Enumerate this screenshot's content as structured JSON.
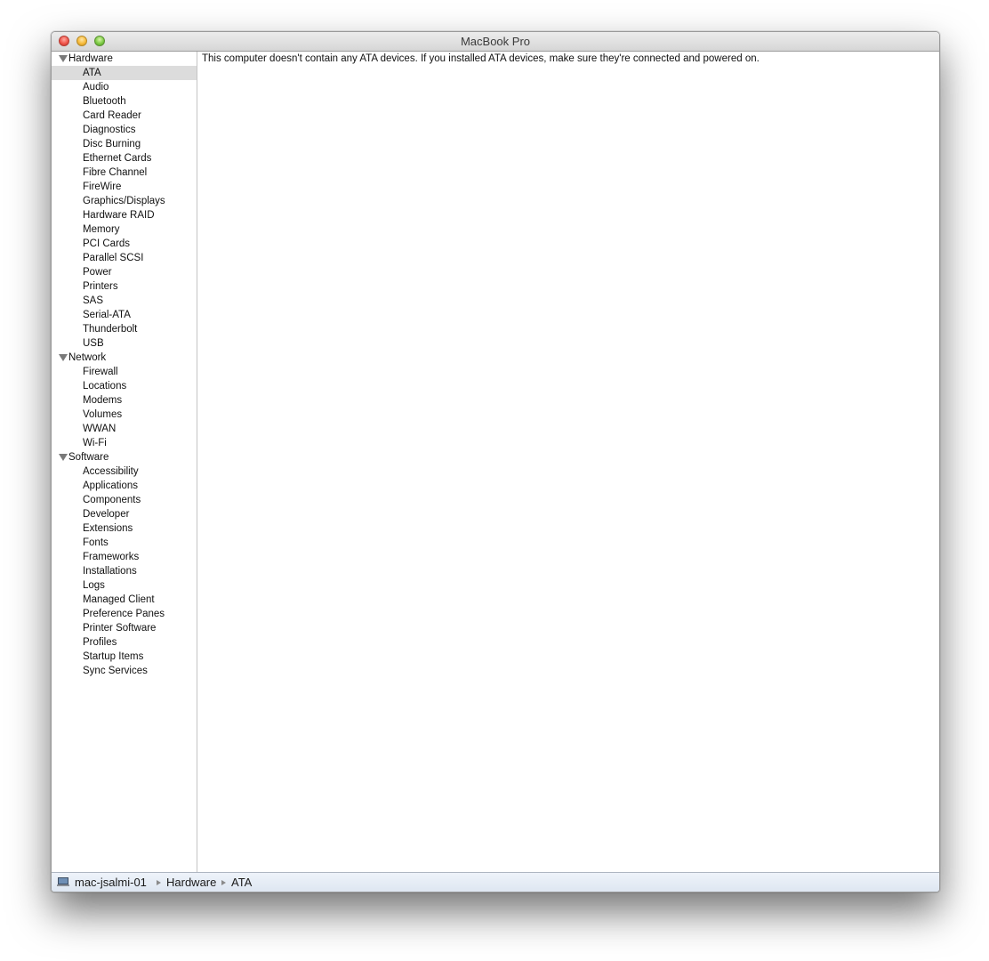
{
  "window": {
    "title": "MacBook Pro"
  },
  "sidebar": {
    "groups": [
      {
        "label": "Hardware",
        "items": [
          "ATA",
          "Audio",
          "Bluetooth",
          "Card Reader",
          "Diagnostics",
          "Disc Burning",
          "Ethernet Cards",
          "Fibre Channel",
          "FireWire",
          "Graphics/Displays",
          "Hardware RAID",
          "Memory",
          "PCI Cards",
          "Parallel SCSI",
          "Power",
          "Printers",
          "SAS",
          "Serial-ATA",
          "Thunderbolt",
          "USB"
        ]
      },
      {
        "label": "Network",
        "items": [
          "Firewall",
          "Locations",
          "Modems",
          "Volumes",
          "WWAN",
          "Wi-Fi"
        ]
      },
      {
        "label": "Software",
        "items": [
          "Accessibility",
          "Applications",
          "Components",
          "Developer",
          "Extensions",
          "Fonts",
          "Frameworks",
          "Installations",
          "Logs",
          "Managed Client",
          "Preference Panes",
          "Printer Software",
          "Profiles",
          "Startup Items",
          "Sync Services"
        ]
      }
    ],
    "selected": "ATA"
  },
  "content": {
    "message": "This computer doesn't contain any ATA devices. If you installed ATA devices, make sure they're connected and powered on."
  },
  "pathbar": {
    "computer_icon": "laptop-icon",
    "items": [
      "mac-jsalmi-01",
      "Hardware",
      "ATA"
    ]
  }
}
